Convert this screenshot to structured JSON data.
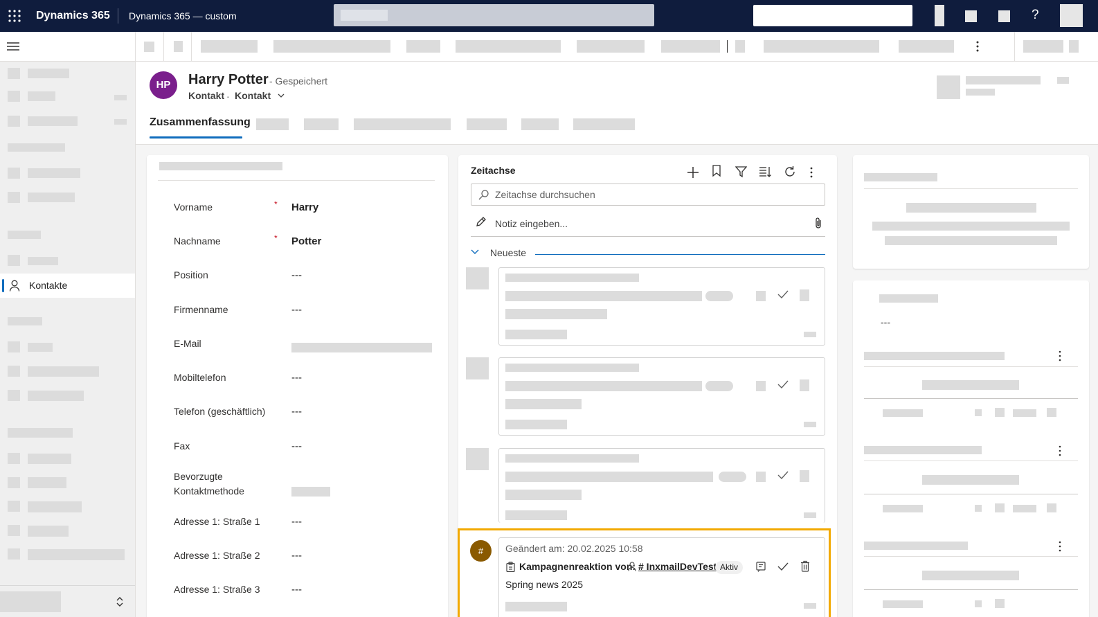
{
  "app": {
    "name": "Dynamics 365",
    "area": "Dynamics 365 — custom"
  },
  "nav": {
    "active_item": "Kontakte"
  },
  "record": {
    "initials": "HP",
    "name": "Harry Potter",
    "status": "- Gespeichert",
    "entity": "Kontakt",
    "separator": "·",
    "form": "Kontakt"
  },
  "tabs": {
    "active": "Zusammenfassung"
  },
  "form": {
    "fields": [
      {
        "label": "Vorname",
        "value": "Harry",
        "required": "*"
      },
      {
        "label": "Nachname",
        "value": "Potter",
        "required": "*"
      },
      {
        "label": "Position",
        "value": "---"
      },
      {
        "label": "Firmenname",
        "value": "---"
      },
      {
        "label": "E-Mail",
        "value": ""
      },
      {
        "label": "Mobiltelefon",
        "value": "---"
      },
      {
        "label": "Telefon (geschäftlich)",
        "value": "---"
      },
      {
        "label": "Fax",
        "value": "---"
      },
      {
        "label": "Bevorzugte Kontaktmethode",
        "value": ""
      },
      {
        "label": "Adresse 1: Straße 1",
        "value": "---"
      },
      {
        "label": "Adresse 1: Straße 2",
        "value": "---"
      },
      {
        "label": "Adresse 1: Straße 3",
        "value": "---"
      }
    ]
  },
  "timeline": {
    "title": "Zeitachse",
    "search_placeholder": "Zeitachse durchsuchen",
    "note_placeholder": "Notiz eingeben...",
    "group_label": "Neueste",
    "highlight": {
      "icon_glyph": "#",
      "modified": "Geändert am: 20.02.2025 10:58",
      "title_prefix": "Kampagnenreaktion von:",
      "link": "# InxmailDevTest",
      "badge": "Aktiv",
      "body": "Spring news 2025"
    }
  },
  "right_panel": {
    "value": "---"
  },
  "colors": {
    "topbar": "#0f1c3d",
    "avatar": "#7a1f8c",
    "accent": "#0f6cbd",
    "highlight_border": "#f2a900",
    "campaign_icon": "#8a5a00"
  }
}
